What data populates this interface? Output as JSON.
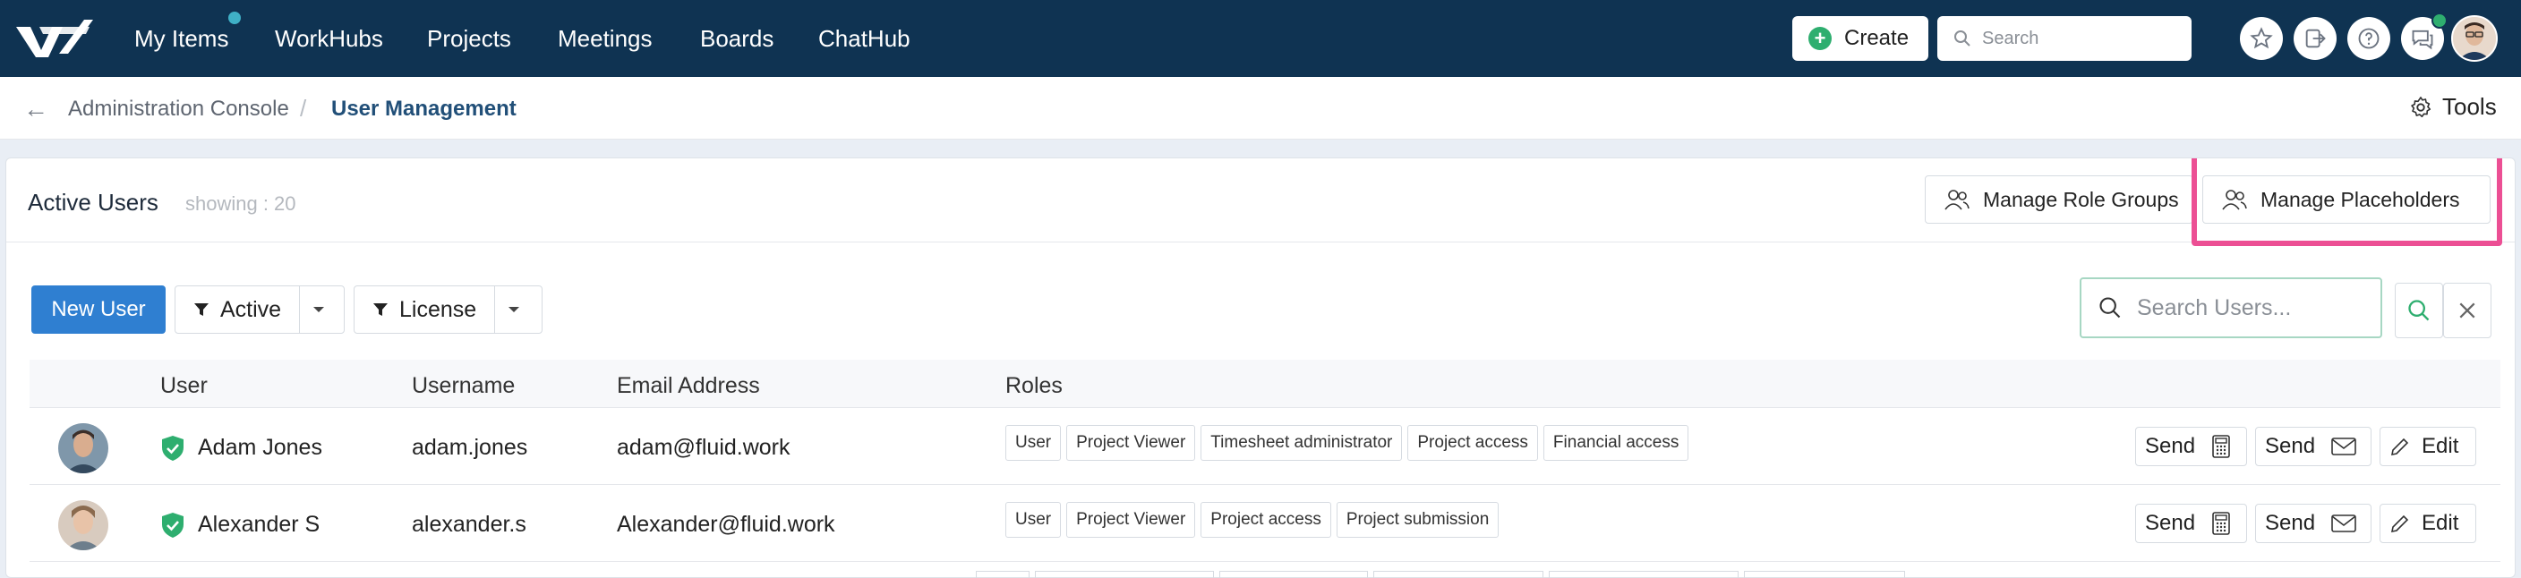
{
  "nav": {
    "items": [
      {
        "label": "My Items"
      },
      {
        "label": "WorkHubs"
      },
      {
        "label": "Projects"
      },
      {
        "label": "Meetings"
      },
      {
        "label": "Boards"
      },
      {
        "label": "ChatHub"
      }
    ],
    "create_label": "Create",
    "search_placeholder": "Search",
    "icons": [
      "star-icon",
      "sign-out-icon",
      "help-icon",
      "chat-icon"
    ],
    "colors": {
      "bar": "#0f3352",
      "badge": "#3fb0c6",
      "create": "#2eae6f"
    }
  },
  "breadcrumb": {
    "parent": "Administration Console",
    "current": "User Management",
    "tools_label": "Tools"
  },
  "card": {
    "title": "Active Users",
    "showing": "showing : 20",
    "manage_role_groups": "Manage Role Groups",
    "manage_placeholders": "Manage Placeholders",
    "new_user": "New User",
    "filter_status": "Active",
    "filter_license": "License",
    "search_placeholder": "Search Users...",
    "highlight_color": "#ec4f94"
  },
  "table": {
    "headers": {
      "user": "User",
      "username": "Username",
      "email": "Email Address",
      "roles": "Roles"
    },
    "rows": [
      {
        "name": "Adam Jones",
        "username": "adam.jones",
        "email": "adam@fluid.work",
        "roles": [
          "User",
          "Project Viewer",
          "Timesheet administrator",
          "Project access",
          "Financial access"
        ]
      },
      {
        "name": "Alexander S",
        "username": "alexander.s",
        "email": "Alexander@fluid.work",
        "roles": [
          "User",
          "Project Viewer",
          "Project access",
          "Project submission"
        ]
      }
    ],
    "actions": {
      "send": "Send",
      "edit": "Edit"
    }
  }
}
